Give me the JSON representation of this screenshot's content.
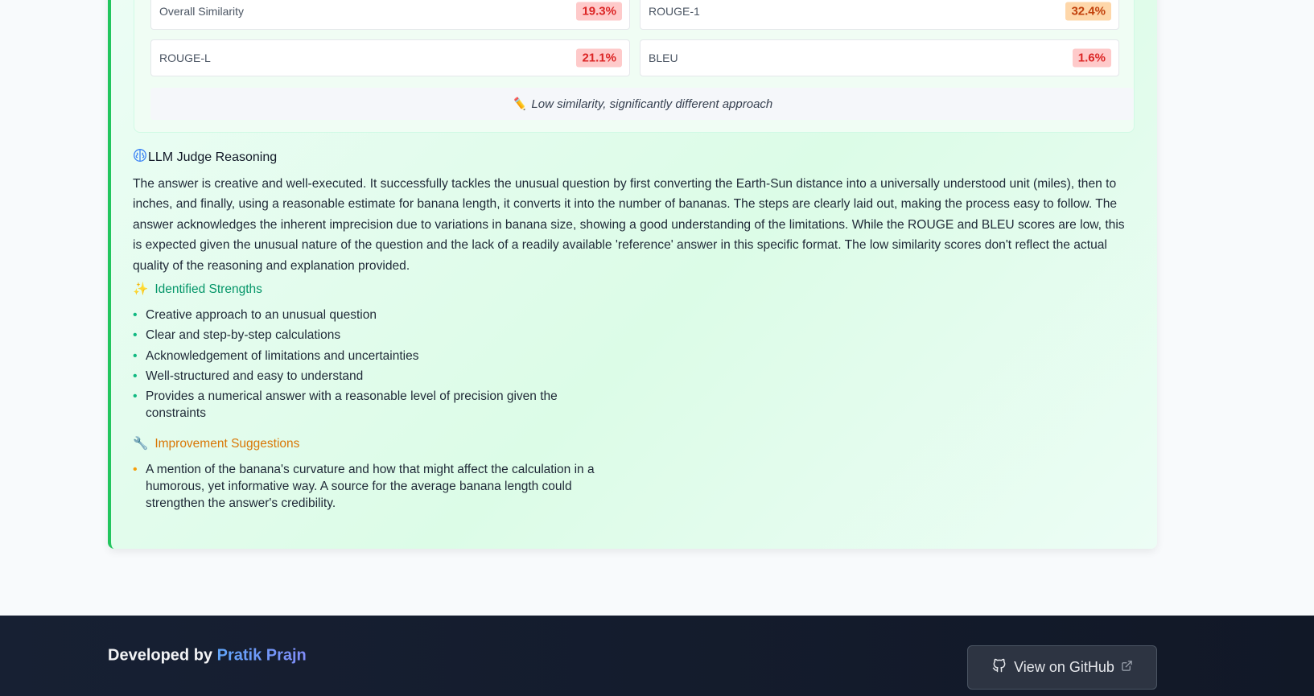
{
  "metrics": [
    {
      "label": "Overall Similarity",
      "value": "19.3%"
    },
    {
      "label": "ROUGE-1",
      "value": "32.4%"
    },
    {
      "label": "ROUGE-L",
      "value": "21.1%"
    },
    {
      "label": "BLEU",
      "value": "1.6%"
    }
  ],
  "similarity_note": {
    "icon": "✏️",
    "text": "Low similarity, significantly different approach"
  },
  "judge": {
    "title": "LLM Judge Reasoning",
    "reasoning": "The answer is creative and well-executed. It successfully tackles the unusual question by first converting the Earth-Sun distance into a universally understood unit (miles), then to inches, and finally, using a reasonable estimate for banana length, it converts it into the number of bananas. The steps are clearly laid out, making the process easy to follow. The answer acknowledges the inherent imprecision due to variations in banana size, showing a good understanding of the limitations. While the ROUGE and BLEU scores are low, this is expected given the unusual nature of the question and the lack of a readily available 'reference' answer in this specific format. The low similarity scores don't reflect the actual quality of the reasoning and explanation provided."
  },
  "strengths": {
    "icon": "✨",
    "title": "Identified Strengths",
    "items": [
      "Creative approach to an unusual question",
      "Clear and step-by-step calculations",
      "Acknowledgement of limitations and uncertainties",
      "Well-structured and easy to understand",
      "Provides a numerical answer with a reasonable level of precision given the constraints"
    ]
  },
  "improvements": {
    "icon": "🔧",
    "title": "Improvement Suggestions",
    "items": [
      "A mention of the banana's curvature and how that might affect the calculation in a humorous, yet informative way. A source for the average banana length could strengthen the answer's credibility."
    ]
  },
  "footer": {
    "developed_by": "Developed by",
    "author": "Pratik Prajn",
    "github_label": "View on GitHub"
  },
  "colors": {
    "accent_green": "#22c55e",
    "strength_green": "#059669",
    "improve_orange": "#d97706",
    "low_score_red": "#dc2626",
    "mid_score_orange": "#c2410c"
  }
}
